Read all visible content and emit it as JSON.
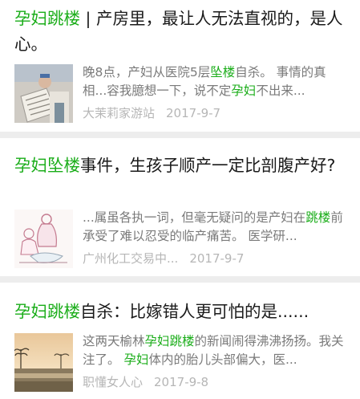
{
  "results": [
    {
      "title_highlight": "孕妇跳楼",
      "title_rest": " | 产房里，最让人无法直视的，是人心。",
      "snippet_parts": [
        {
          "t": "晚8点，产妇从医院5层",
          "hl": false
        },
        {
          "t": "坠楼",
          "hl": true
        },
        {
          "t": "自杀。 事情的真相...容我臆想一下，说不定",
          "hl": false
        },
        {
          "t": "孕妇",
          "hl": true
        },
        {
          "t": "不出来...",
          "hl": false
        }
      ],
      "source": "大茉莉家游站",
      "date": "2017-9-7",
      "thumbnail_icon": "newspaper-reader-photo"
    },
    {
      "title_parts": [
        {
          "t": "孕妇坠楼",
          "hl": true
        },
        {
          "t": "事件，生孩子顺产一定比剖腹产好?",
          "hl": false
        }
      ],
      "snippet_parts": [
        {
          "t": "...属虽各执一词，但毫无疑问的是产妇在",
          "hl": false
        },
        {
          "t": "跳楼",
          "hl": true
        },
        {
          "t": "前承受了难以忍受的临产痛苦。 医学研...",
          "hl": false
        }
      ],
      "source": "广州化工交易中...",
      "date": "2017-9-7",
      "thumbnail_icon": "mother-baby-illustration"
    },
    {
      "title_parts": [
        {
          "t": "孕妇跳楼",
          "hl": true
        },
        {
          "t": "自杀：比嫁错人更可怕的是......",
          "hl": false
        }
      ],
      "snippet_parts": [
        {
          "t": "这两天榆林",
          "hl": false
        },
        {
          "t": "孕妇跳楼",
          "hl": true
        },
        {
          "t": "的新闻闹得沸沸扬扬。我关注了。 ",
          "hl": false
        },
        {
          "t": "孕妇",
          "hl": true
        },
        {
          "t": "体内的胎儿头部偏大，医...",
          "hl": false
        }
      ],
      "source": "职懂女人心",
      "date": "2017-9-8",
      "thumbnail_icon": "sunset-lake-photo"
    }
  ],
  "colors": {
    "highlight": "#1aad19",
    "background": "#ededed",
    "meta": "#b6b6b6"
  }
}
